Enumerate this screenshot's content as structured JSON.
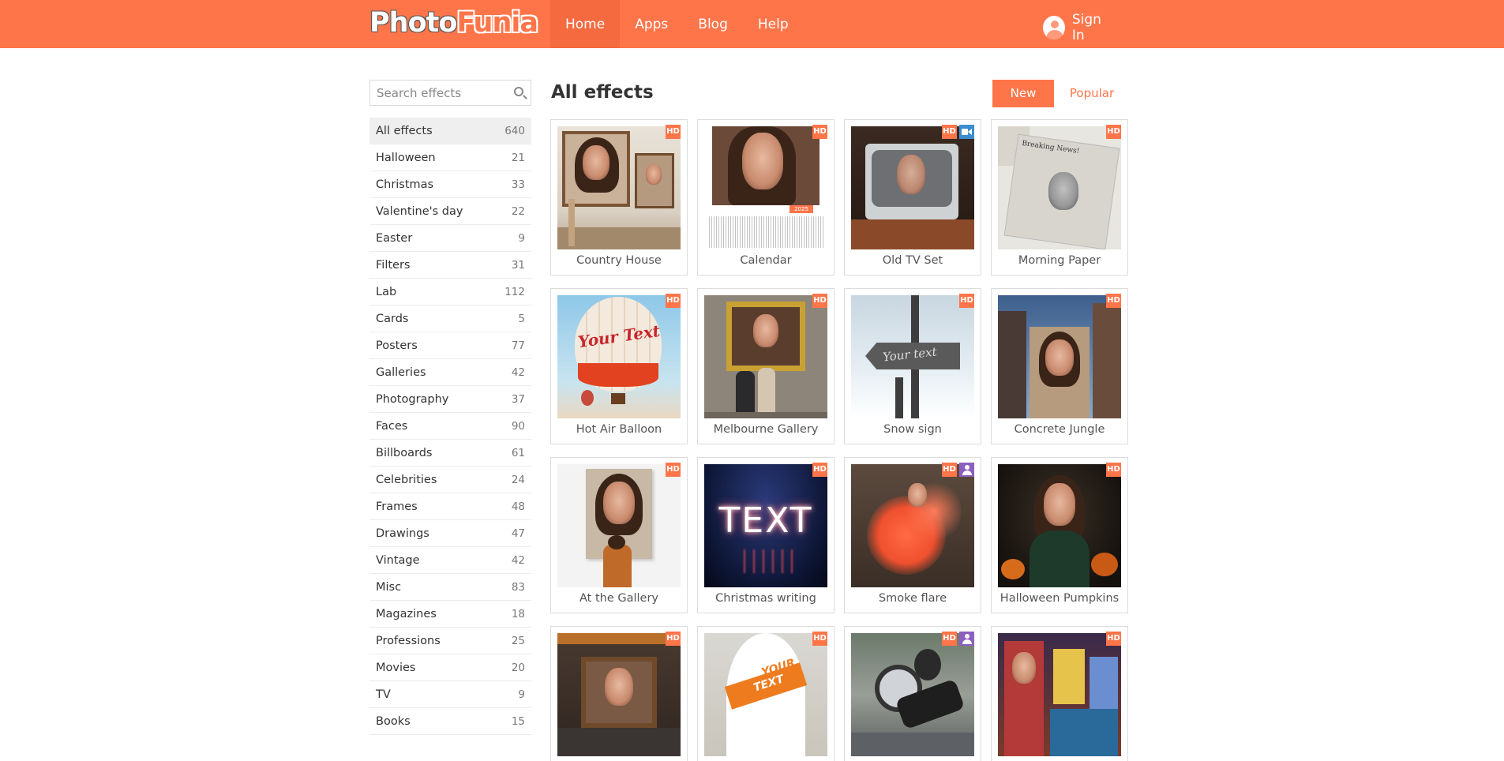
{
  "header": {
    "logo_part1": "Photo",
    "logo_part2": "Funia",
    "nav": [
      {
        "label": "Home",
        "active": true
      },
      {
        "label": "Apps"
      },
      {
        "label": "Blog"
      },
      {
        "label": "Help"
      }
    ],
    "signin_label": "Sign In",
    "accent_color": "#ff754a"
  },
  "sidebar": {
    "search_placeholder": "Search effects",
    "categories": [
      {
        "label": "All effects",
        "count": "640"
      },
      {
        "label": "Halloween",
        "count": "21"
      },
      {
        "label": "Christmas",
        "count": "33"
      },
      {
        "label": "Valentine's day",
        "count": "22"
      },
      {
        "label": "Easter",
        "count": "9"
      },
      {
        "label": "Filters",
        "count": "31"
      },
      {
        "label": "Lab",
        "count": "112"
      },
      {
        "label": "Cards",
        "count": "5"
      },
      {
        "label": "Posters",
        "count": "77"
      },
      {
        "label": "Galleries",
        "count": "42"
      },
      {
        "label": "Photography",
        "count": "37"
      },
      {
        "label": "Faces",
        "count": "90"
      },
      {
        "label": "Billboards",
        "count": "61"
      },
      {
        "label": "Celebrities",
        "count": "24"
      },
      {
        "label": "Frames",
        "count": "48"
      },
      {
        "label": "Drawings",
        "count": "47"
      },
      {
        "label": "Vintage",
        "count": "42"
      },
      {
        "label": "Misc",
        "count": "83"
      },
      {
        "label": "Magazines",
        "count": "18"
      },
      {
        "label": "Professions",
        "count": "25"
      },
      {
        "label": "Movies",
        "count": "20"
      },
      {
        "label": "TV",
        "count": "9"
      },
      {
        "label": "Books",
        "count": "15"
      }
    ]
  },
  "main": {
    "title": "All effects",
    "sort_new": "New",
    "sort_popular": "Popular",
    "hd_label": "HD",
    "effects": [
      {
        "label": "Country House",
        "badges": [
          "hd"
        ]
      },
      {
        "label": "Calendar",
        "badges": [
          "hd"
        ]
      },
      {
        "label": "Old TV Set",
        "badges": [
          "hd",
          "video"
        ]
      },
      {
        "label": "Morning Paper",
        "badges": [
          "hd"
        ]
      },
      {
        "label": "Hot Air Balloon",
        "badges": [
          "hd"
        ]
      },
      {
        "label": "Melbourne Gallery",
        "badges": [
          "hd"
        ]
      },
      {
        "label": "Snow sign",
        "badges": [
          "hd"
        ]
      },
      {
        "label": "Concrete Jungle",
        "badges": [
          "hd"
        ]
      },
      {
        "label": "At the Gallery",
        "badges": [
          "hd"
        ]
      },
      {
        "label": "Christmas writing",
        "badges": [
          "hd"
        ]
      },
      {
        "label": "Smoke flare",
        "badges": [
          "hd",
          "person"
        ]
      },
      {
        "label": "Halloween Pumpkins",
        "badges": [
          "hd"
        ]
      },
      {
        "label": "",
        "badges": [
          "hd"
        ]
      },
      {
        "label": "",
        "badges": [
          "hd"
        ]
      },
      {
        "label": "",
        "badges": [
          "hd",
          "person"
        ]
      },
      {
        "label": "",
        "badges": [
          "hd"
        ]
      }
    ],
    "thumb_text": {
      "calendar_year": "2025",
      "balloon_text": "Your Text",
      "snow_sign_text": "Your text",
      "christmas_text": "TEXT",
      "surf_text_1": "YOUR",
      "surf_text_2": "TEXT",
      "paper_headline": "Breaking News!"
    }
  }
}
